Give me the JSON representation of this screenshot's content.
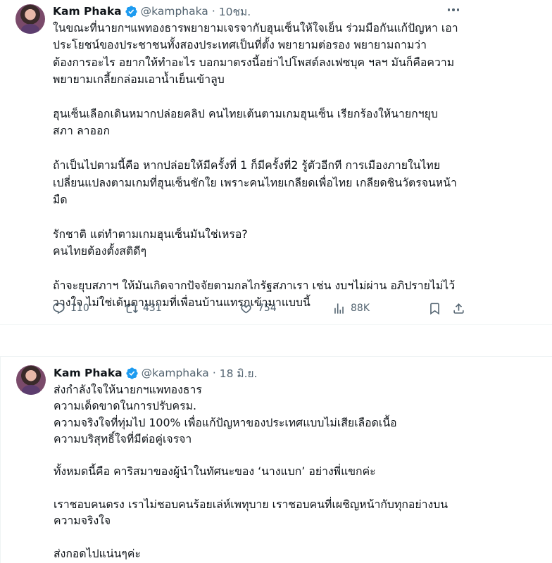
{
  "tweets": [
    {
      "author": {
        "name": "Kam Phaka",
        "handle": "@kamphaka",
        "verified": true
      },
      "time": "10ชม.",
      "paragraphs": [
        "ในขณะที่นายกฯแพทองธารพยายามเจรจากับฮุนเซ็นให้ใจเย็น ร่วมมือกันแก้ปัญหา เอา\nประโยชน์ของประชาชนทั้งสองประเทศเป็นที่ตั้ง พยายามต่อรอง พยายามถามว่า\nต้องการอะไร อยากให้ทำอะไร บอกมาตรงนี้อย่าไปโพสต์ลงเฟซบุค ฯลฯ มันก็คือความ\nพยายามเกลี้ยกล่อมเอาน้ำเย็นเข้าลูบ",
        "ฮุนเซ็นเลือกเดินหมากปล่อยคลิป คนไทยเต้นตามเกมฮุนเซ็น เรียกร้องให้นายกฯยุบ\nสภา ลาออก",
        "ถ้าเป็นไปตามนี้คือ หากปล่อยให้มีครั้งที่ 1 ก็มีครั้งที่2 รู้ตัวอีกที การเมืองภายในไทย\nเปลี่ยนแปลงตามเกมที่ฮุนเซ็นชักใย เพราะคนไทยเกลียดเพื่อไทย เกลียดชินวัตรจนหน้า\nมืด",
        "รักชาติ แต่ทำตามเกมฮุนเซ็นมันใช่เหรอ?\nคนไทยต้องตั้งสติดีๆ",
        "ถ้าจะยุบสภาฯ ให้มันเกิดจากปัจจัยตามกลไกรัฐสภาเรา เช่น งบฯไม่ผ่าน อภิปรายไม่ไว้\nวางใจ ไม่ใช่เต้นตามเกมที่เพื่อนบ้านแทรกเข้ามาแบบนี้"
      ],
      "stats": {
        "replies": "110",
        "reposts": "431",
        "likes": "754",
        "views": "88K"
      }
    },
    {
      "author": {
        "name": "Kam Phaka",
        "handle": "@kamphaka",
        "verified": true
      },
      "time": "18 มิ.ย.",
      "paragraphs": [
        "ส่งกำลังใจให้นายกฯแพทองธาร\nความเด็ดขาดในการปรับครม.\nความจริงใจที่ทุ่มไป 100% เพื่อแก้ปัญหาของประเทศแบบไม่เสียเลือดเนื้อ\nความบริสุทธิ์ใจที่มีต่อคู่เจรจา",
        "ทั้งหมดนี้คือ คาริสมาของผู้นำในทัศนะของ ‘นางแบก’ อย่างพี่แขกค่ะ",
        "เราชอบคนตรง เราไม่ชอบคนร้อยเล่ห์เพทุบาย เราชอบคนที่เผชิญหน้ากับทุกอย่างบน\nความจริงใจ",
        "ส่งกอดไปแน่นๆค่ะ"
      ]
    }
  ],
  "colors": {
    "text": "#0f1419",
    "secondary": "#536471",
    "verified": "#1d9bf0",
    "divider": "#eff3f4"
  },
  "icons": [
    "verified-badge-icon",
    "more-options-icon",
    "reply-icon",
    "repost-icon",
    "like-icon",
    "views-icon",
    "bookmark-icon",
    "share-icon"
  ]
}
